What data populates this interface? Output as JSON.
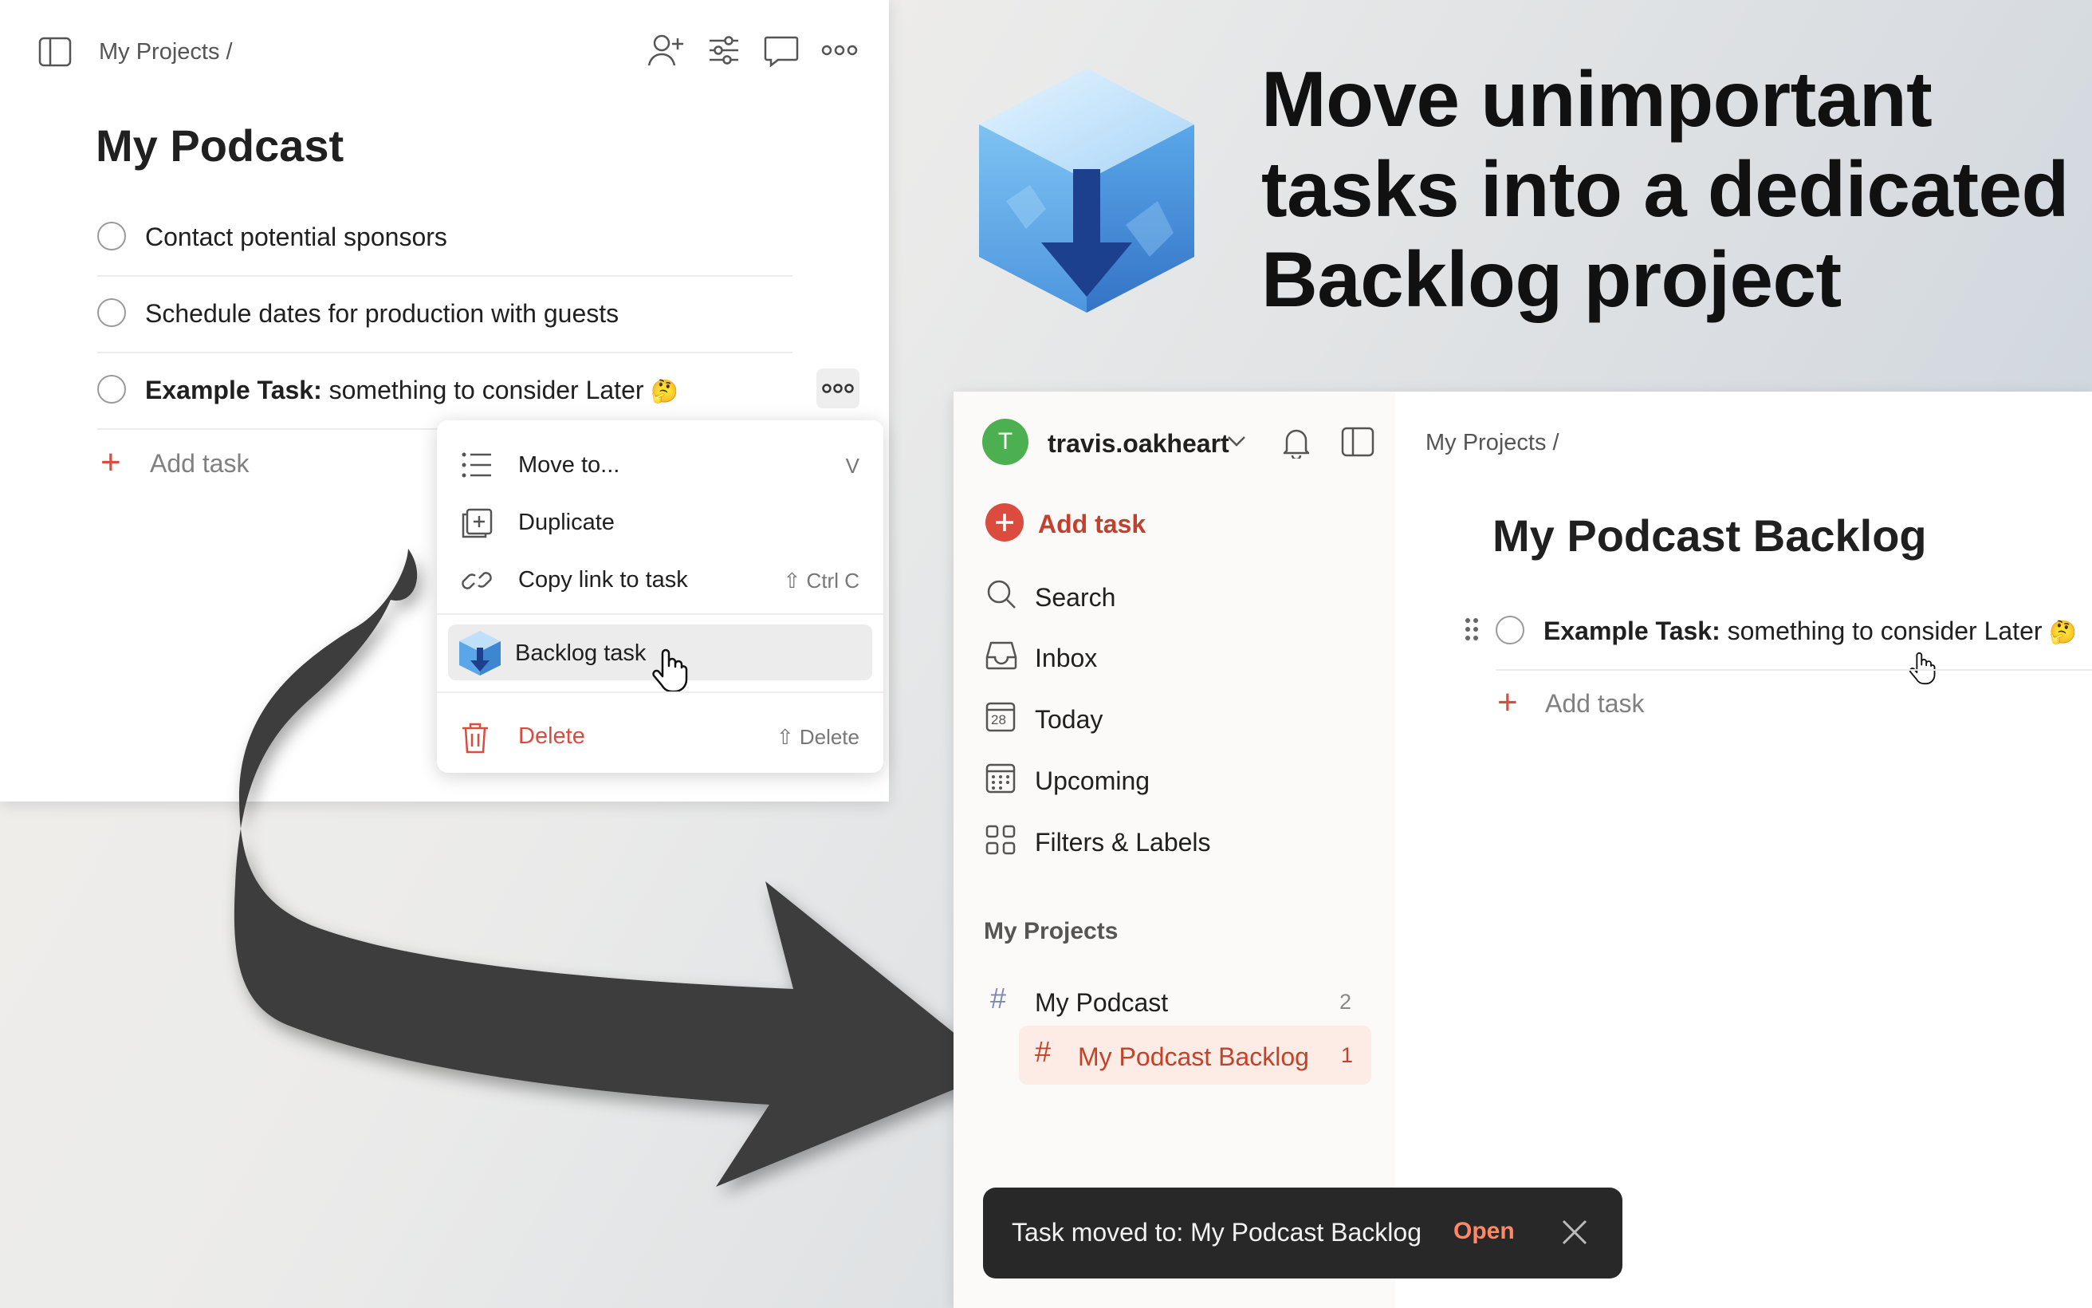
{
  "left": {
    "breadcrumb": "My Projects /",
    "title": "My Podcast",
    "tasks": [
      {
        "text": "Contact potential sponsors"
      },
      {
        "text": "Schedule dates for production with guests"
      },
      {
        "bold_prefix": "Example Task:",
        "text": " something to consider Later",
        "emoji": "🤔"
      }
    ],
    "add_task": "Add task",
    "menu": {
      "move_to": {
        "label": "Move to...",
        "shortcut": "V"
      },
      "duplicate": {
        "label": "Duplicate"
      },
      "copy_link": {
        "label": "Copy link to task",
        "shortcut": "⇧ Ctrl C"
      },
      "backlog": {
        "label": "Backlog task"
      },
      "delete": {
        "label": "Delete",
        "shortcut": "⇧ Delete"
      }
    }
  },
  "headline": {
    "line1": "Move unimportant",
    "line2": "tasks into a dedicated",
    "line3": "Backlog project"
  },
  "right": {
    "user": {
      "initial": "T",
      "name": "travis.oakheart",
      "avatar_color": "#4caf50"
    },
    "add_task": "Add task",
    "nav": [
      {
        "label": "Search",
        "icon": "search-icon"
      },
      {
        "label": "Inbox",
        "icon": "inbox-icon"
      },
      {
        "label": "Today",
        "icon": "today-calendar-icon",
        "badge": "28"
      },
      {
        "label": "Upcoming",
        "icon": "upcoming-calendar-icon"
      },
      {
        "label": "Filters & Labels",
        "icon": "filters-grid-icon"
      }
    ],
    "projects_header": "My Projects",
    "projects": [
      {
        "name": "My Podcast",
        "count": "2"
      },
      {
        "name": "My Podcast Backlog",
        "count": "1"
      }
    ],
    "breadcrumb": "My Projects /",
    "title": "My Podcast Backlog",
    "task": {
      "bold_prefix": "Example Task:",
      "text": " something to consider Later",
      "emoji": "🤔"
    },
    "add_task_inline": "Add task"
  },
  "toast": {
    "message": "Task moved to: My Podcast Backlog",
    "action": "Open"
  },
  "colors": {
    "accent": "#db4c3f",
    "selected_project_bg": "#fdece6",
    "selected_project_text": "#c44228",
    "toast_bg": "#282828",
    "toast_action": "#ff8866"
  }
}
